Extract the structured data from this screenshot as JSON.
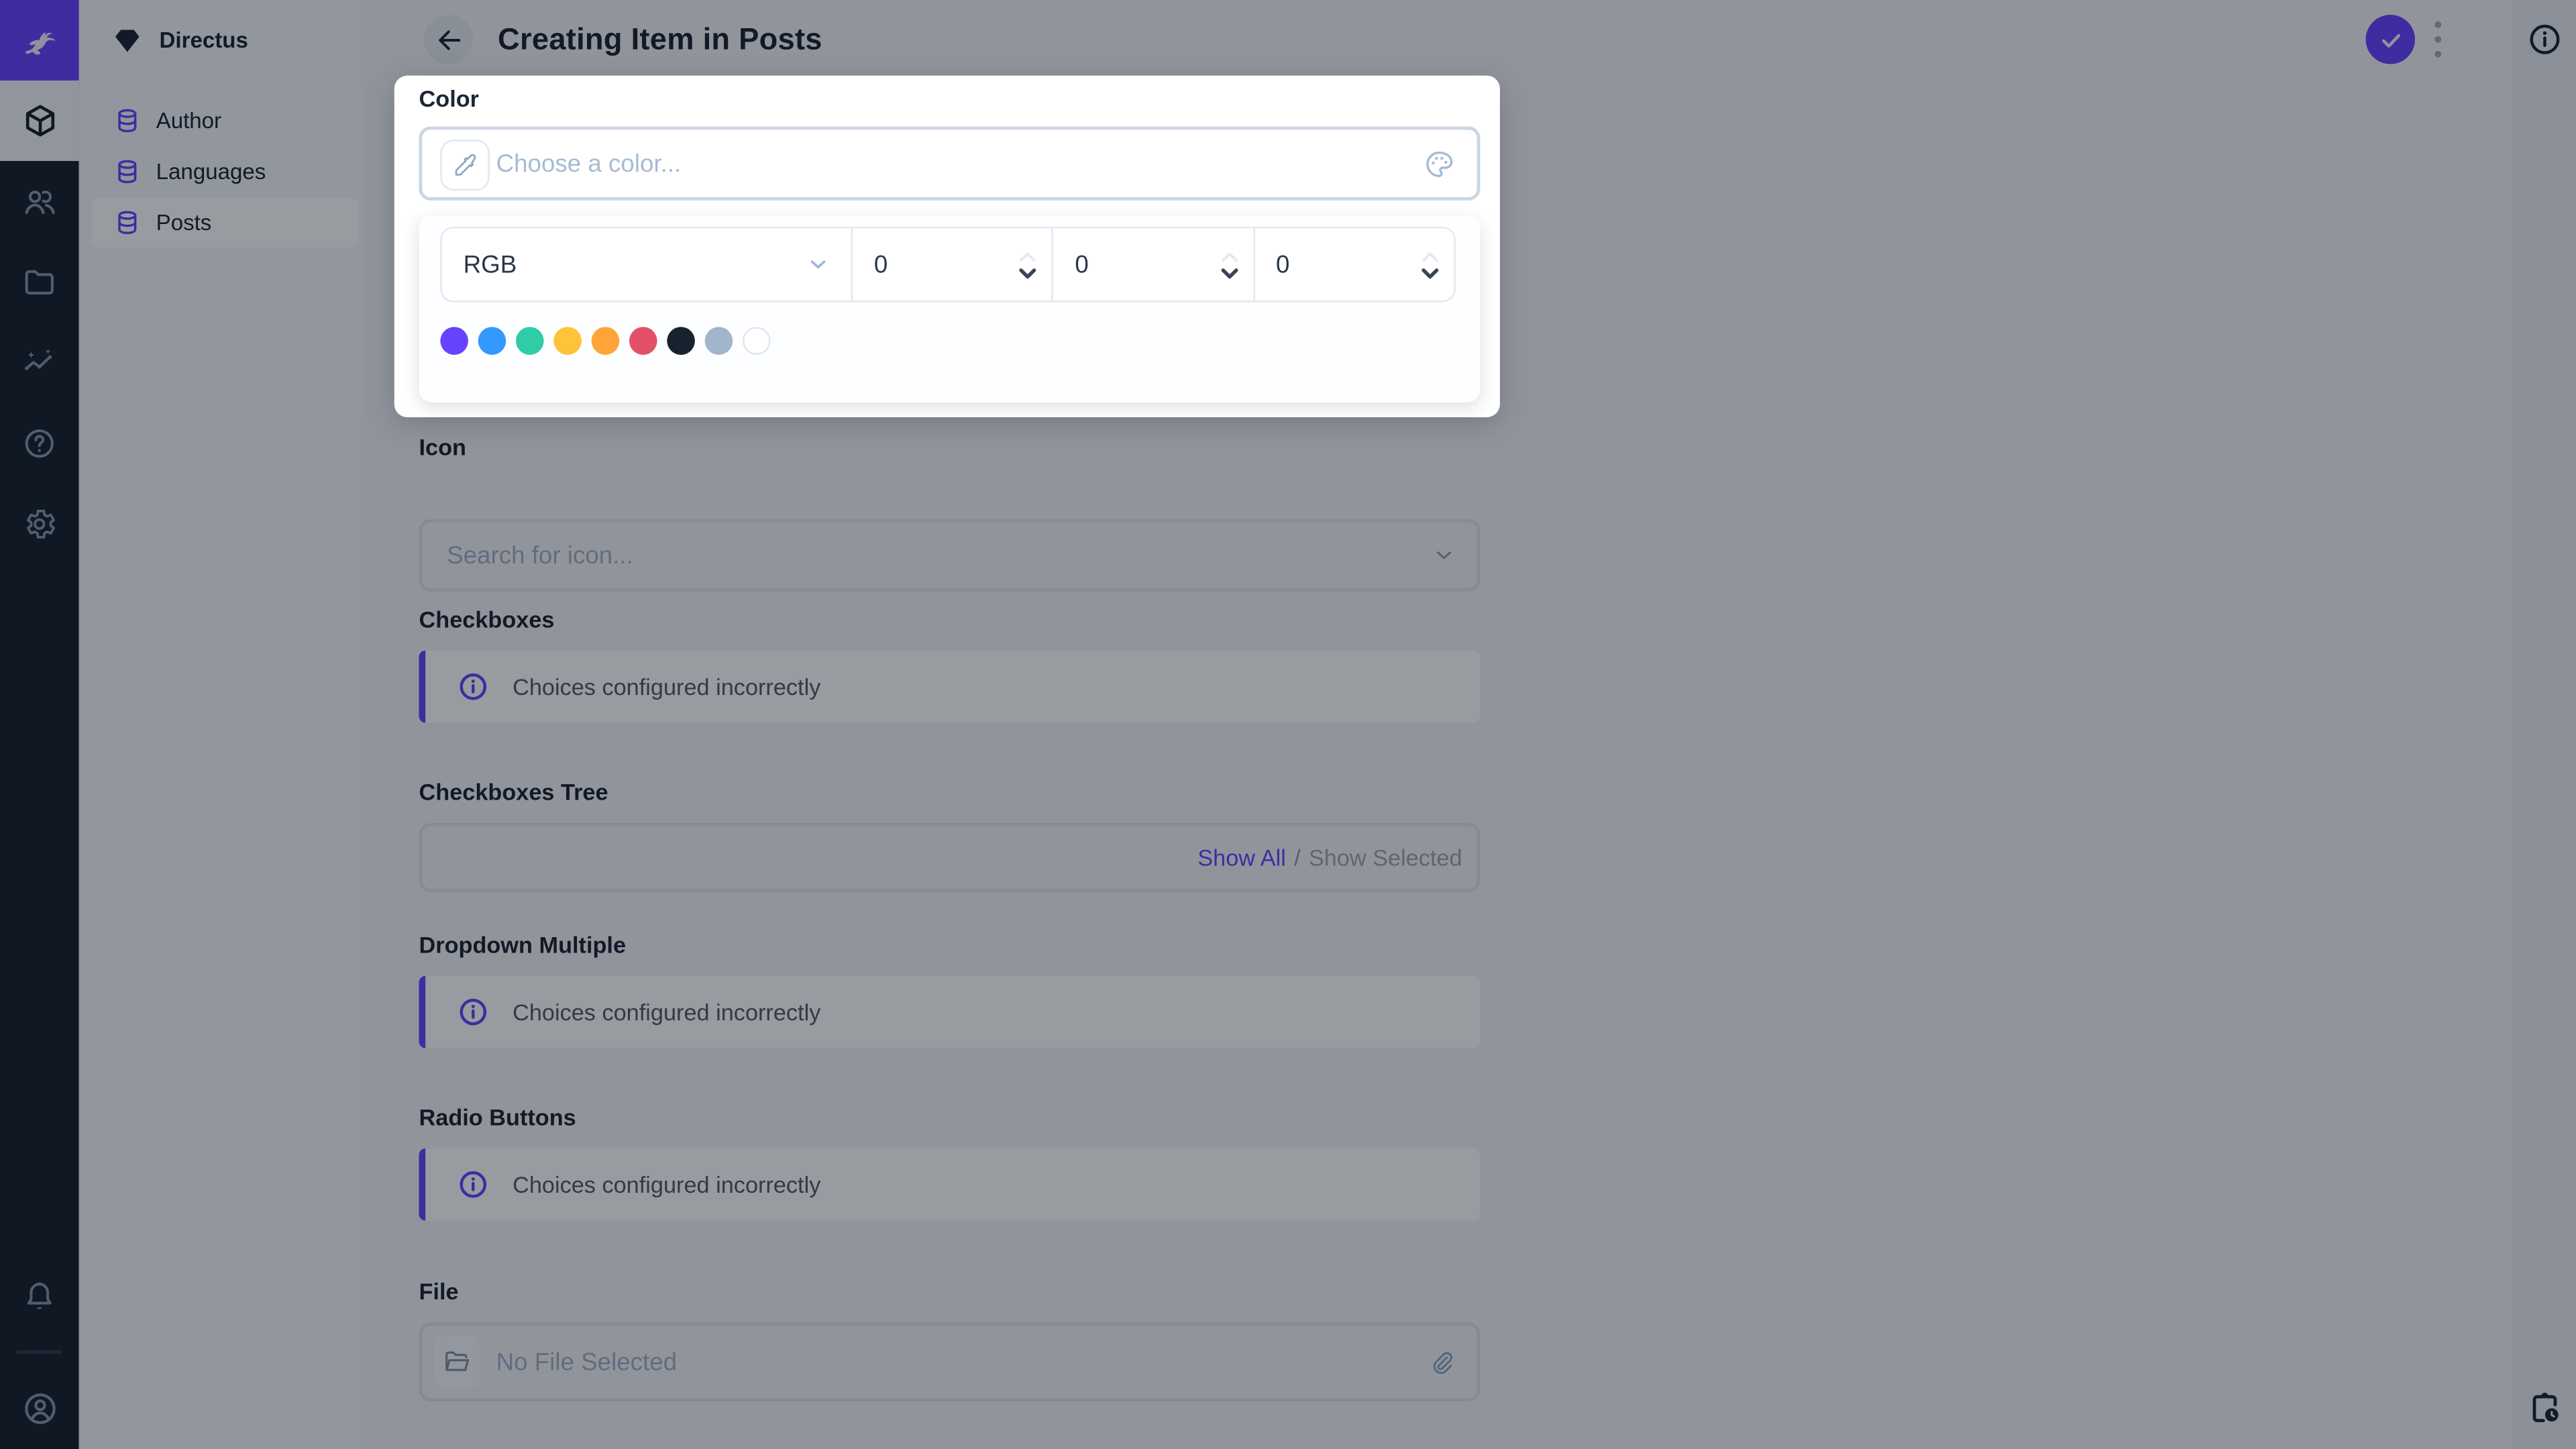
{
  "colors": {
    "accent": "#6644FF",
    "module_bar_bg": "#18222F",
    "nav_bg": "#F0F4F9",
    "page_bg": "#EEF2F6"
  },
  "module_bar": {
    "logo_icon": "directus-rabbit-logo",
    "modules": [
      "content",
      "users",
      "files",
      "insights",
      "help",
      "settings"
    ],
    "bottom": [
      "notifications",
      "account"
    ]
  },
  "sidebar": {
    "project_name": "Directus",
    "project_icon": "gem-icon",
    "items": [
      {
        "label": "Author"
      },
      {
        "label": "Languages"
      },
      {
        "label": "Posts"
      }
    ]
  },
  "header": {
    "title": "Creating Item in Posts",
    "back_icon": "arrow-left",
    "save_icon": "check",
    "more_icon": "kebab-menu",
    "info_icon": "info"
  },
  "right_strip": {
    "top_icon": "info",
    "bottom_icon": "revisions-clipboard-clock"
  },
  "color_popup": {
    "label": "Color",
    "input_placeholder": "Choose a color...",
    "eyedropper_icon": "eyedropper",
    "palette_icon": "palette",
    "mode": "RGB",
    "values": [
      "0",
      "0",
      "0"
    ],
    "swatches": [
      "#6644FF",
      "#3399FF",
      "#2ECDA7",
      "#FFC23B",
      "#FFA439",
      "#E35169",
      "#18222F",
      "#A2B5CD",
      "#FFFFFF"
    ]
  },
  "fields": {
    "icon": {
      "label": "Icon",
      "placeholder": "Search for icon..."
    },
    "checkboxes": {
      "label": "Checkboxes",
      "notice": "Choices configured incorrectly"
    },
    "checkboxes_tree": {
      "label": "Checkboxes Tree",
      "show_all": "Show All",
      "separator": "/",
      "show_selected": "Show Selected"
    },
    "dropdown_multiple": {
      "label": "Dropdown Multiple",
      "notice": "Choices configured incorrectly"
    },
    "radio_buttons": {
      "label": "Radio Buttons",
      "notice": "Choices configured incorrectly"
    },
    "file": {
      "label": "File",
      "placeholder": "No File Selected"
    }
  }
}
